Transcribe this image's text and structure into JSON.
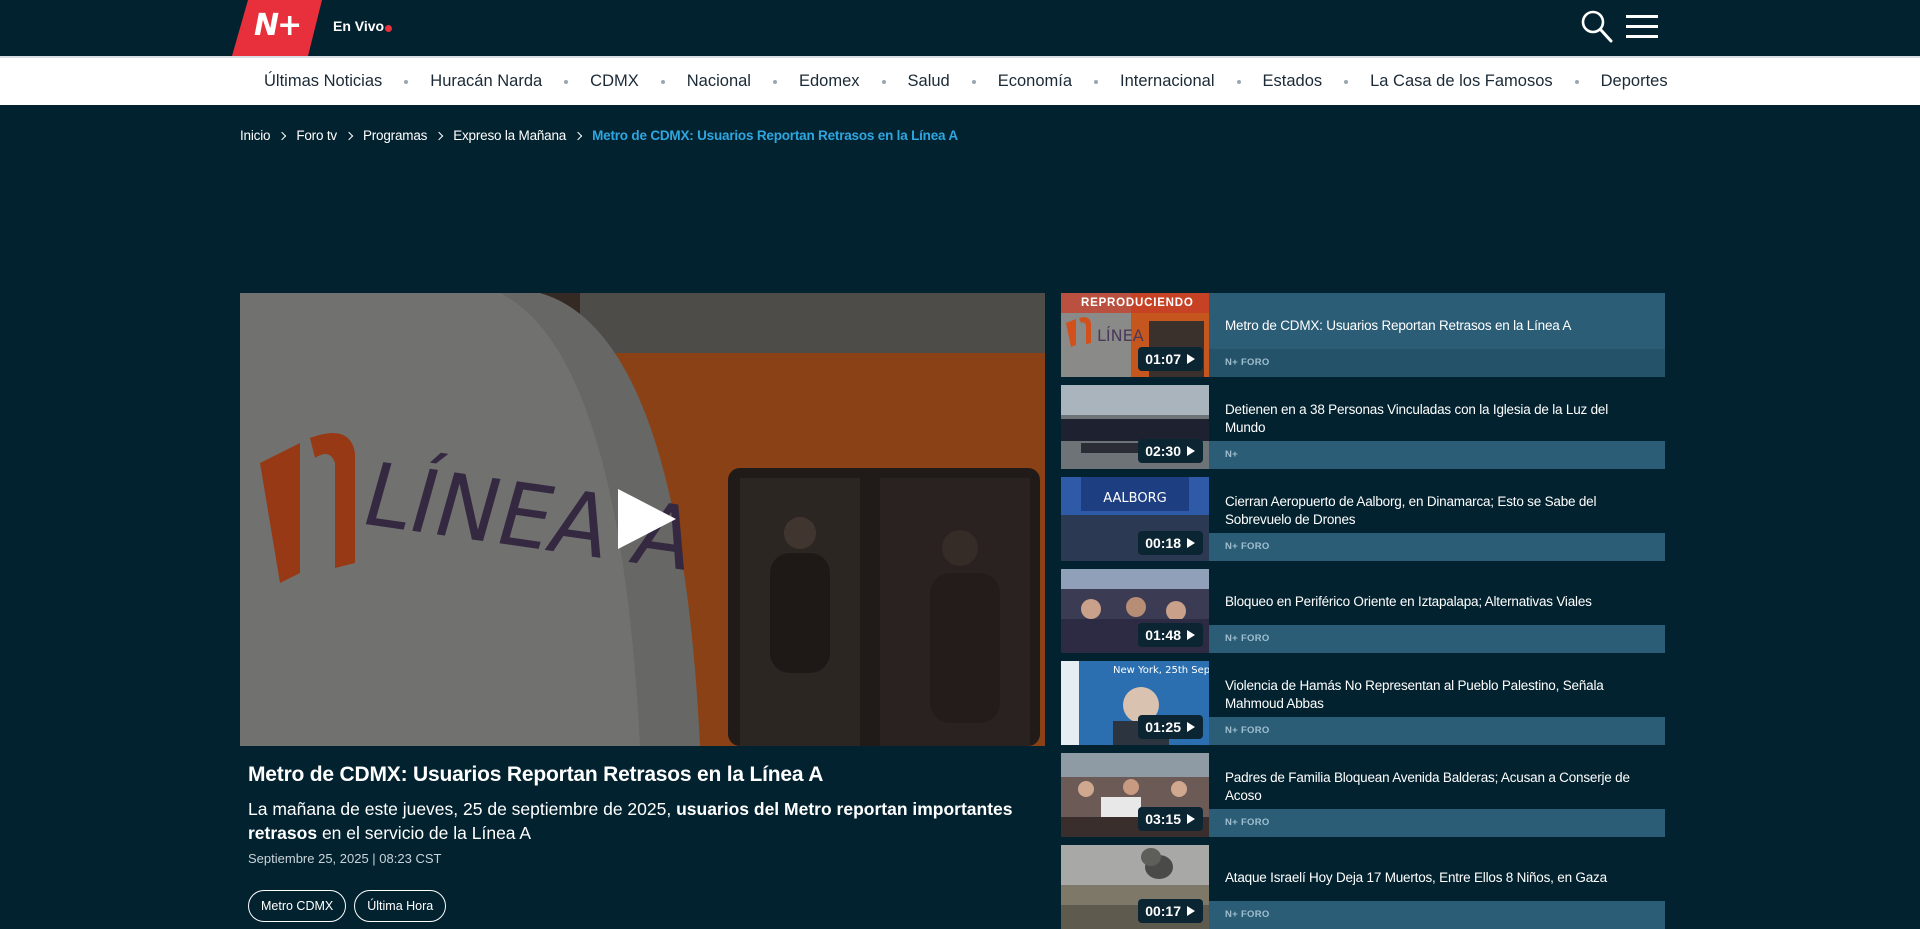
{
  "header": {
    "logo": "N+",
    "live_label": "En Vivo"
  },
  "nav": {
    "items": [
      "Últimas Noticias",
      "Huracán Narda",
      "CDMX",
      "Nacional",
      "Edomex",
      "Salud",
      "Economía",
      "Internacional",
      "Estados",
      "La Casa de los Famosos",
      "Deportes"
    ]
  },
  "breadcrumb": {
    "items": [
      "Inicio",
      "Foro tv",
      "Programas",
      "Expreso la Mañana"
    ],
    "current": "Metro de CDMX: Usuarios Reportan Retrasos en la Línea A"
  },
  "video": {
    "title": "Metro de CDMX: Usuarios Reportan Retrasos en la Línea A",
    "description_plain_1": "La mañana de este jueves, 25 de septiembre de 2025, ",
    "description_bold": "usuarios del Metro reportan importantes retrasos",
    "description_plain_2": " en el servicio de la Línea A",
    "date": "Septiembre 25, 2025 | 08:23 CST",
    "tags": [
      "Metro CDMX",
      "Última Hora"
    ],
    "thumbnail_text": "LÍNEA A"
  },
  "playlist": {
    "now_playing_label": "REPRODUCIENDO",
    "items": [
      {
        "title": "Metro de CDMX: Usuarios Reportan Retrasos en la Línea A",
        "duration": "01:07",
        "source": "N+ FORO"
      },
      {
        "title": "Detienen en a 38 Personas Vinculadas con la Iglesia de la Luz del Mundo",
        "duration": "02:30",
        "source": "N+"
      },
      {
        "title": "Cierran Aeropuerto de Aalborg, en Dinamarca; Esto se Sabe del Sobrevuelo de Drones",
        "duration": "00:18",
        "source": "N+ FORO",
        "thumb_text": "AALBORG"
      },
      {
        "title": "Bloqueo en Periférico Oriente en Iztapalapa; Alternativas Viales",
        "duration": "01:48",
        "source": "N+ FORO"
      },
      {
        "title": "Violencia de Hamás No Representan al Pueblo Palestino, Señala Mahmoud Abbas",
        "duration": "01:25",
        "source": "N+ FORO",
        "thumb_text": "New York, 25th Sep"
      },
      {
        "title": "Padres de Familia Bloquean Avenida Balderas; Acusan a Conserje de Acoso",
        "duration": "03:15",
        "source": "N+ FORO"
      },
      {
        "title": "Ataque Israelí Hoy Deja 17 Muertos, Entre Ellos 8 Niños, en Gaza",
        "duration": "00:17",
        "source": "N+ FORO"
      }
    ]
  },
  "colors": {
    "background": "#03222f",
    "brand_red": "#e8303c",
    "accent_blue": "#2ea6e0",
    "playlist_panel": "#2b5d77"
  }
}
